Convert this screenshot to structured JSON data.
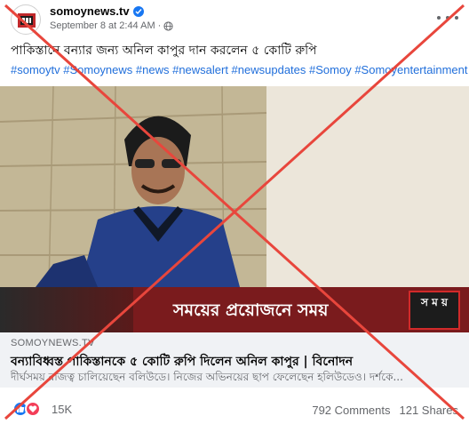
{
  "post": {
    "page_name": "somoynews.tv",
    "timestamp": "September 8 at 2:44 AM",
    "separator": "·",
    "caption": "পাকিস্তানে বন্যার জন্য অনিল কাপুর দান করলেন ৫ কোটি রুপি",
    "hashtags": "#somoytv #Somoynews #news #newsalert #newsupdates #Somoy #Somoyentertainment"
  },
  "image": {
    "banner_text": "সময়ের প্রয়োজনে সময়",
    "logo_text": "স ম য়"
  },
  "link_preview": {
    "domain": "SOMOYNEWS.TV",
    "title": "বন্যাবিধ্বস্ত পাকিস্তানকে ৫ কোটি রুপি দিলেন অনিল কাপুর | বিনোদন",
    "description": "দীর্ঘসময় রাজত্ব চালিয়েছেন বলিউডে। নিজের অভিনয়ের ছাপ ফেলেছেন হলিউডেও। দর্শকে..."
  },
  "footer": {
    "reaction_count": "15K",
    "comments": "792 Comments",
    "shares": "121 Shares"
  },
  "colors": {
    "accent": "#1877f2",
    "love": "#f33e58",
    "cross": "#e8463c",
    "banner": "#7a1b1d"
  },
  "icons": [
    "verified-badge-icon",
    "globe-icon",
    "more-options-icon",
    "like-reaction-icon",
    "love-reaction-icon"
  ]
}
